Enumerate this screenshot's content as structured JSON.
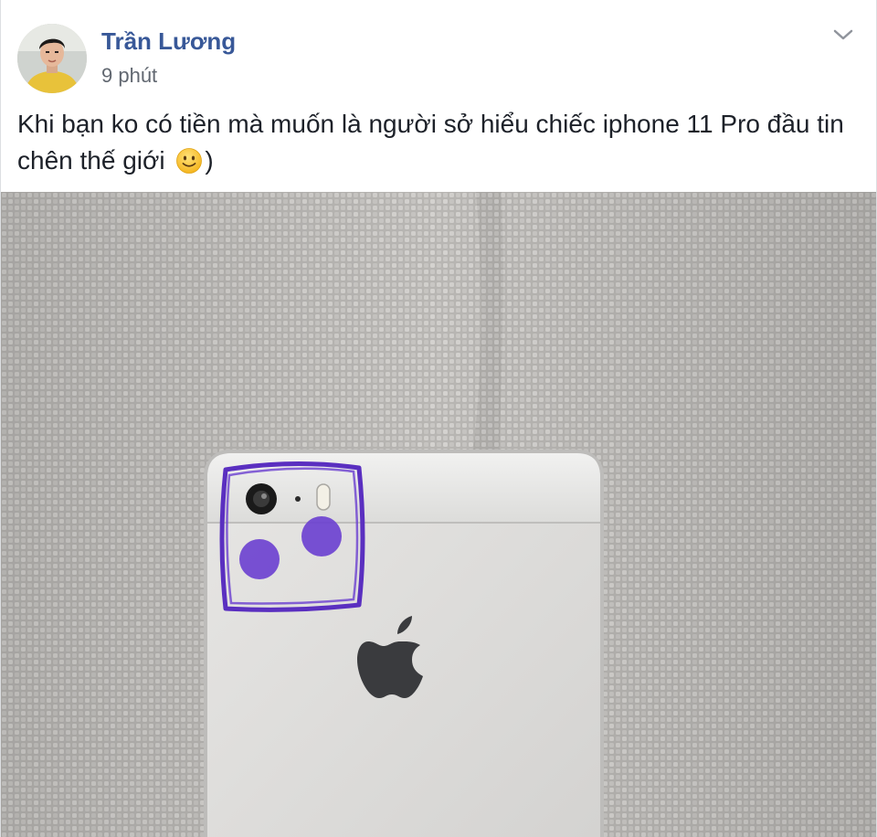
{
  "post": {
    "author": {
      "name": "Trần Lương",
      "avatar_icon": "user-avatar"
    },
    "timestamp": "9 phút",
    "menu_icon": "chevron-down-icon",
    "text": {
      "line1": "Khi bạn ko có tiền mà muốn là người sở hiểu chiếc iphone 11 Pro đầu tin",
      "line2_before_emoji": "chên thế giới",
      "emoji": "slightly-smiling-face-icon",
      "line2_after_emoji": ")"
    },
    "photo": {
      "subject_icon": "apple-logo-icon",
      "colors": {
        "fabric": "#b9b7b4",
        "phone_body": "#e1e0de",
        "marker": "#5a2fc0"
      }
    }
  }
}
